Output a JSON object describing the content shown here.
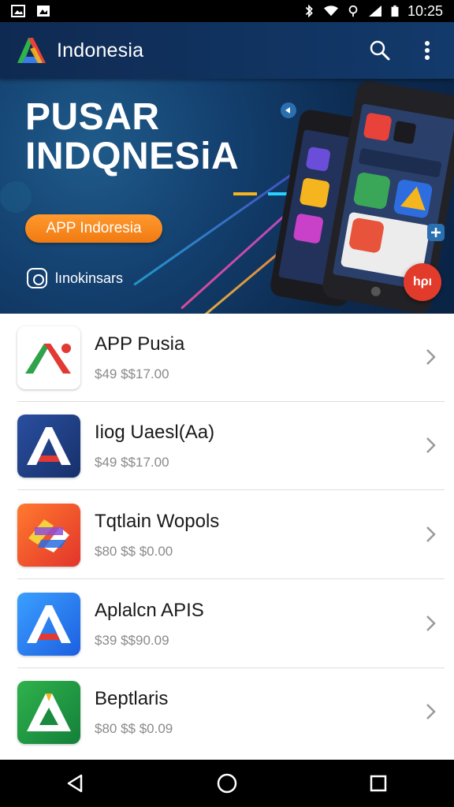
{
  "status_bar": {
    "time": "10:25",
    "left_icons": [
      "gallery-icon",
      "image-icon"
    ],
    "right_icons": [
      "bluetooth-icon",
      "wifi-icon",
      "data-icon",
      "signal-icon",
      "battery-icon"
    ]
  },
  "app_bar": {
    "title": "Indonesia",
    "logo_icon": "app-logo-icon",
    "actions": [
      "search-icon",
      "more-vert-icon"
    ]
  },
  "banner": {
    "title_line1": "PUSAR",
    "title_line2": "INDQNESiA",
    "cta_label": "APP Indoresia",
    "social_handle": "lınokinsars",
    "badge_text": "hρı"
  },
  "apps": [
    {
      "name": "APP Pusia",
      "price": "$49 $$17.00",
      "icon": "red-green-a-icon"
    },
    {
      "name": "Iiog Uaesl(Aa)",
      "price": "$49 $$17.00",
      "icon": "blue-a-icon"
    },
    {
      "name": "Tqtlain Wopols",
      "price": "$80 $$ $0.00",
      "icon": "orange-a-icon"
    },
    {
      "name": "Aplalcn APIS",
      "price": "$39 $$90.09",
      "icon": "lightblue-a-icon"
    },
    {
      "name": "Beptlaris",
      "price": "$80 $$ $0.09",
      "icon": "green-a-icon"
    }
  ],
  "colors": {
    "app_bar": "#123a6b",
    "banner_bg": "#0c2a4f",
    "cta": "#f07a12",
    "accent_red": "#e33b2b"
  },
  "nav": [
    "back-icon",
    "home-icon",
    "recents-icon"
  ]
}
